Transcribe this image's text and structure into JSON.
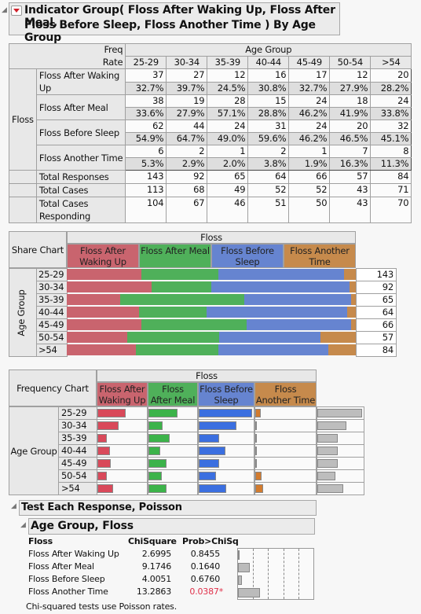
{
  "header": {
    "title_line1": "Indicator Group(   Floss After Waking Up,   Floss After Meal,",
    "title_line2": "Floss Before Sleep,   Floss Another Time  ) By Age Group",
    "collapse_icon": "disclosure-triangle-icon",
    "menu_icon": "red-triangle-menu-icon"
  },
  "colors": {
    "waking": "#c9646e",
    "meal": "#4fb05a",
    "sleep": "#6684d0",
    "another": "#c68a4c",
    "waking_bar": "#d9495a",
    "meal_bar": "#3cb34a",
    "sleep_bar": "#3b6fe0",
    "another_bar": "#d27b2e",
    "total_bar": "#bdbdbd",
    "significant": "#e0304a"
  },
  "crosstab": {
    "freq_label": "Freq",
    "rate_label": "Rate",
    "col_group_label": "Age Group",
    "row_group_label": "Floss",
    "columns": [
      "25-29",
      "30-34",
      "35-39",
      "40-44",
      "45-49",
      "50-54",
      ">54"
    ],
    "rows": [
      {
        "label": "Floss After Waking Up",
        "label_l1": "Floss After Waking",
        "label_l2": "Up",
        "freq": [
          "37",
          "27",
          "12",
          "16",
          "17",
          "12",
          "20"
        ],
        "rate": [
          "32.7%",
          "39.7%",
          "24.5%",
          "30.8%",
          "32.7%",
          "27.9%",
          "28.2%"
        ]
      },
      {
        "label": "Floss After Meal",
        "freq": [
          "38",
          "19",
          "28",
          "15",
          "24",
          "18",
          "24"
        ],
        "rate": [
          "33.6%",
          "27.9%",
          "57.1%",
          "28.8%",
          "46.2%",
          "41.9%",
          "33.8%"
        ]
      },
      {
        "label": "Floss Before Sleep",
        "freq": [
          "62",
          "44",
          "24",
          "31",
          "24",
          "20",
          "32"
        ],
        "rate": [
          "54.9%",
          "64.7%",
          "49.0%",
          "59.6%",
          "46.2%",
          "46.5%",
          "45.1%"
        ]
      },
      {
        "label": "Floss Another Time",
        "freq": [
          "6",
          "2",
          "1",
          "2",
          "1",
          "7",
          "8"
        ],
        "rate": [
          "5.3%",
          "2.9%",
          "2.0%",
          "3.8%",
          "1.9%",
          "16.3%",
          "11.3%"
        ]
      }
    ],
    "totals": [
      {
        "label": "Total Responses",
        "values": [
          "143",
          "92",
          "65",
          "64",
          "66",
          "57",
          "84"
        ]
      },
      {
        "label": "Total Cases",
        "values": [
          "113",
          "68",
          "49",
          "52",
          "52",
          "43",
          "71"
        ]
      },
      {
        "label_l1": "Total Cases",
        "label_l2": "Responding",
        "values": [
          "104",
          "67",
          "46",
          "51",
          "50",
          "43",
          "70"
        ]
      }
    ]
  },
  "share_chart": {
    "title": "Share Chart",
    "group_label": "Floss",
    "axis_label": "Age Group",
    "categories": [
      {
        "l1": "Floss After",
        "l2": "Waking Up"
      },
      {
        "l1": "Floss After Meal",
        "l2": ""
      },
      {
        "l1": "Floss Before",
        "l2": "Sleep"
      },
      {
        "l1": "Floss Another",
        "l2": "Time"
      }
    ],
    "rows": [
      "25-29",
      "30-34",
      "35-39",
      "40-44",
      "45-49",
      "50-54",
      ">54"
    ],
    "totals": [
      "143",
      "92",
      "65",
      "64",
      "66",
      "57",
      "84"
    ]
  },
  "frequency_chart": {
    "title": "Frequency Chart",
    "group_label": "Floss",
    "axis_label": "Age Group",
    "categories": [
      {
        "l1": "Floss After",
        "l2": "Waking Up"
      },
      {
        "l1": "Floss",
        "l2": "After Meal"
      },
      {
        "l1": "Floss Before",
        "l2": "Sleep"
      },
      {
        "l1": "Floss",
        "l2": "Another Time"
      }
    ],
    "rows": [
      "25-29",
      "30-34",
      "35-39",
      "40-44",
      "45-49",
      "50-54",
      ">54"
    ]
  },
  "chart_data": [
    {
      "type": "bar",
      "title": "Share Chart",
      "stacked": true,
      "normalized": true,
      "categories": [
        "25-29",
        "30-34",
        "35-39",
        "40-44",
        "45-49",
        "50-54",
        ">54"
      ],
      "series": [
        {
          "name": "Floss After Waking Up",
          "values": [
            37,
            27,
            12,
            16,
            17,
            12,
            20
          ]
        },
        {
          "name": "Floss After Meal",
          "values": [
            38,
            19,
            28,
            15,
            24,
            18,
            24
          ]
        },
        {
          "name": "Floss Before Sleep",
          "values": [
            62,
            44,
            24,
            31,
            24,
            20,
            32
          ]
        },
        {
          "name": "Floss Another Time",
          "values": [
            6,
            2,
            1,
            2,
            1,
            7,
            8
          ]
        }
      ],
      "totals": [
        143,
        92,
        65,
        64,
        66,
        57,
        84
      ]
    },
    {
      "type": "bar",
      "title": "Frequency Chart",
      "categories": [
        "25-29",
        "30-34",
        "35-39",
        "40-44",
        "45-49",
        "50-54",
        ">54"
      ],
      "series": [
        {
          "name": "Floss After Waking Up",
          "values": [
            37,
            27,
            12,
            16,
            17,
            12,
            20
          ]
        },
        {
          "name": "Floss After Meal",
          "values": [
            38,
            19,
            28,
            15,
            24,
            18,
            24
          ]
        },
        {
          "name": "Floss Before Sleep",
          "values": [
            62,
            44,
            24,
            31,
            24,
            20,
            32
          ]
        },
        {
          "name": "Floss Another Time",
          "values": [
            6,
            2,
            1,
            2,
            1,
            7,
            8
          ]
        },
        {
          "name": "Total",
          "values": [
            143,
            92,
            65,
            64,
            66,
            57,
            84
          ]
        }
      ],
      "xlim": [
        0,
        62
      ]
    },
    {
      "type": "bar",
      "title": "Prob>ChiSq",
      "categories": [
        "Floss After Waking Up",
        "Floss After Meal",
        "Floss Before Sleep",
        "Floss Another Time"
      ],
      "values": [
        0.8455,
        0.164,
        0.676,
        0.0387
      ],
      "note": "bar length shows 1 - p-value (logworth-style)",
      "xlim": [
        0,
        1
      ]
    }
  ],
  "tests": {
    "section_title": "Test Each Response, Poisson",
    "sub_title": "Age Group, Floss",
    "col_floss": "Floss",
    "col_chisq": "ChiSquare",
    "col_prob": "Prob>ChiSq",
    "rows": [
      {
        "label": "Floss After Waking Up",
        "chisq": "2.6995",
        "prob": "0.8455",
        "sig": false,
        "bar": 0.02
      },
      {
        "label": "Floss After Meal",
        "chisq": "9.1746",
        "prob": "0.1640",
        "sig": false,
        "bar": 0.16
      },
      {
        "label": "Floss Before Sleep",
        "chisq": "4.0051",
        "prob": "0.6760",
        "sig": false,
        "bar": 0.05
      },
      {
        "label": "Floss Another Time",
        "chisq": "13.2863",
        "prob": "0.0387*",
        "sig": true,
        "bar": 0.29
      }
    ],
    "footnote": "Chi-squared tests use Poisson rates."
  }
}
